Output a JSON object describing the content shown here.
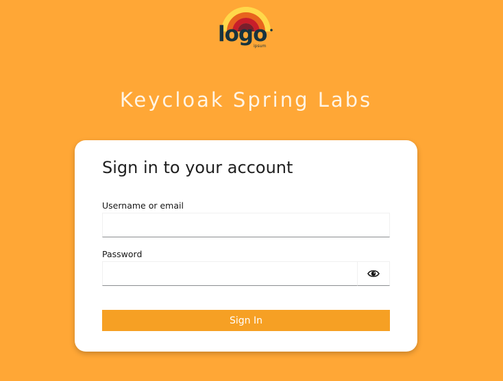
{
  "logo": {
    "main_text": "logo",
    "sub_text": "ipsum"
  },
  "realm": {
    "title": "Keycloak Spring Labs"
  },
  "login_form": {
    "heading": "Sign in to your account",
    "username_label": "Username or email",
    "username_value": "",
    "password_label": "Password",
    "password_value": "",
    "show_password_icon": "eye-icon",
    "submit_label": "Sign In"
  },
  "colors": {
    "background": "#FFA736",
    "button": "#F6A024",
    "card": "#FFFFFF",
    "title_text": "#FFF4E4"
  }
}
